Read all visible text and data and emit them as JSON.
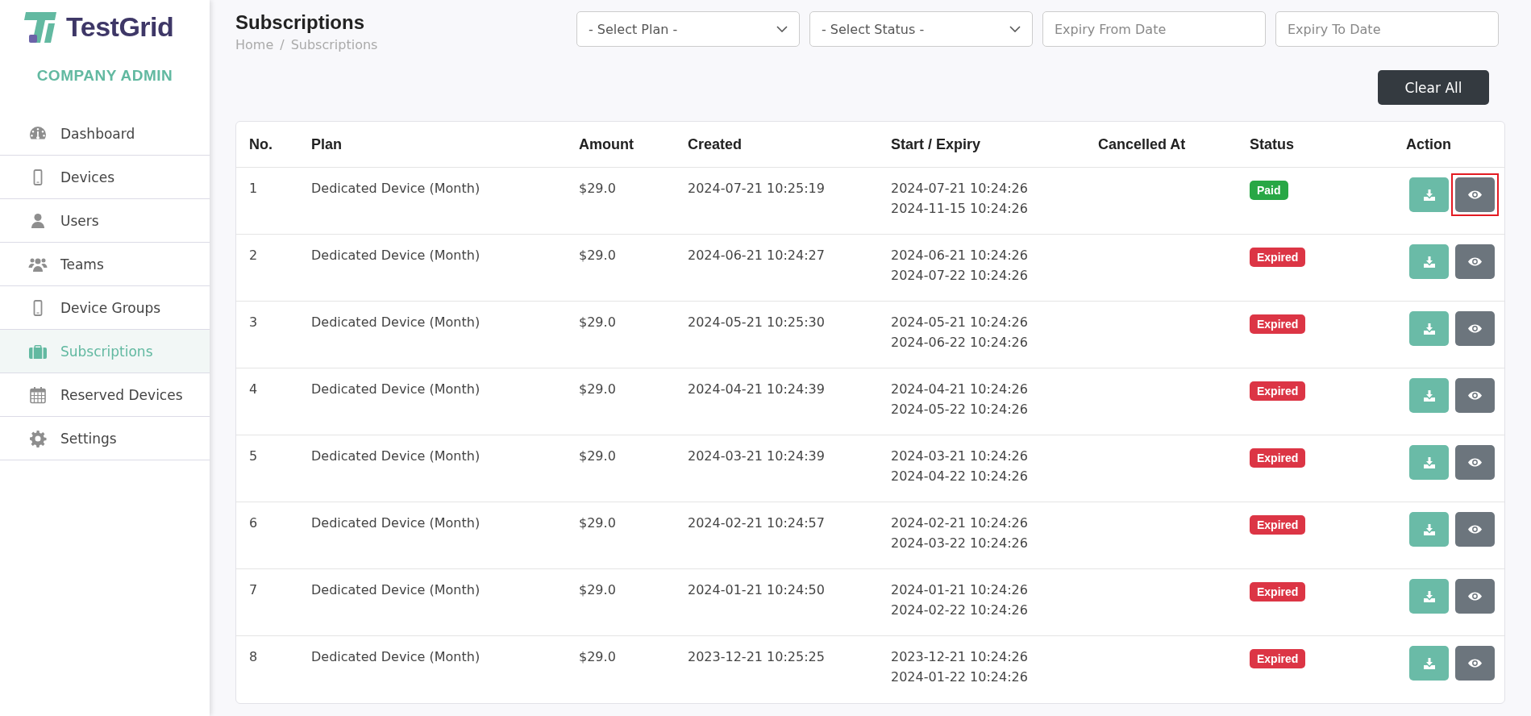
{
  "brand": {
    "name": "TestGrid",
    "role": "COMPANY ADMIN"
  },
  "sidebar": {
    "items": [
      {
        "label": "Dashboard",
        "selected": false
      },
      {
        "label": "Devices",
        "selected": false
      },
      {
        "label": "Users",
        "selected": false
      },
      {
        "label": "Teams",
        "selected": false
      },
      {
        "label": "Device Groups",
        "selected": false
      },
      {
        "label": "Subscriptions",
        "selected": true
      },
      {
        "label": "Reserved Devices",
        "selected": false
      },
      {
        "label": "Settings",
        "selected": false
      }
    ]
  },
  "header": {
    "title": "Subscriptions",
    "breadcrumb": [
      "Home",
      "Subscriptions"
    ],
    "breadcrumb_separator": "/"
  },
  "filters": [
    {
      "kind": "select",
      "placeholder": "- Select Plan -"
    },
    {
      "kind": "select",
      "placeholder": "- Select Status -"
    },
    {
      "kind": "date",
      "placeholder": "Expiry From Date"
    },
    {
      "kind": "date",
      "placeholder": "Expiry To Date"
    }
  ],
  "clear_button": "Clear All",
  "table": {
    "columns": [
      "No.",
      "Plan",
      "Amount",
      "Created",
      "Start / Expiry",
      "Cancelled At",
      "Status",
      "Action"
    ],
    "rows": [
      {
        "no": "1",
        "plan": "Dedicated Device (Month)",
        "amount": "$29.0",
        "created": "2024-07-21 10:25:19",
        "start": "2024-07-21 10:24:26",
        "expiry": "2024-11-15 10:24:26",
        "status": {
          "kind": "paid",
          "label": "Paid"
        },
        "view_highlighted": true
      },
      {
        "no": "2",
        "plan": "Dedicated Device (Month)",
        "amount": "$29.0",
        "created": "2024-06-21 10:24:27",
        "start": "2024-06-21 10:24:26",
        "expiry": "2024-07-22 10:24:26",
        "status": {
          "kind": "expired",
          "label": "Expired"
        },
        "view_highlighted": false
      },
      {
        "no": "3",
        "plan": "Dedicated Device (Month)",
        "amount": "$29.0",
        "created": "2024-05-21 10:25:30",
        "start": "2024-05-21 10:24:26",
        "expiry": "2024-06-22 10:24:26",
        "status": {
          "kind": "expired",
          "label": "Expired"
        },
        "view_highlighted": false
      },
      {
        "no": "4",
        "plan": "Dedicated Device (Month)",
        "amount": "$29.0",
        "created": "2024-04-21 10:24:39",
        "start": "2024-04-21 10:24:26",
        "expiry": "2024-05-22 10:24:26",
        "status": {
          "kind": "expired",
          "label": "Expired"
        },
        "view_highlighted": false
      },
      {
        "no": "5",
        "plan": "Dedicated Device (Month)",
        "amount": "$29.0",
        "created": "2024-03-21 10:24:39",
        "start": "2024-03-21 10:24:26",
        "expiry": "2024-04-22 10:24:26",
        "status": {
          "kind": "expired",
          "label": "Expired"
        },
        "view_highlighted": false
      },
      {
        "no": "6",
        "plan": "Dedicated Device (Month)",
        "amount": "$29.0",
        "created": "2024-02-21 10:24:57",
        "start": "2024-02-21 10:24:26",
        "expiry": "2024-03-22 10:24:26",
        "status": {
          "kind": "expired",
          "label": "Expired"
        },
        "view_highlighted": false
      },
      {
        "no": "7",
        "plan": "Dedicated Device (Month)",
        "amount": "$29.0",
        "created": "2024-01-21 10:24:50",
        "start": "2024-01-21 10:24:26",
        "expiry": "2024-02-22 10:24:26",
        "status": {
          "kind": "expired",
          "label": "Expired"
        },
        "view_highlighted": false
      },
      {
        "no": "8",
        "plan": "Dedicated Device (Month)",
        "amount": "$29.0",
        "created": "2023-12-21 10:25:25",
        "start": "2023-12-21 10:24:26",
        "expiry": "2024-01-22 10:24:26",
        "status": {
          "kind": "expired",
          "label": "Expired"
        },
        "view_highlighted": false
      }
    ]
  }
}
